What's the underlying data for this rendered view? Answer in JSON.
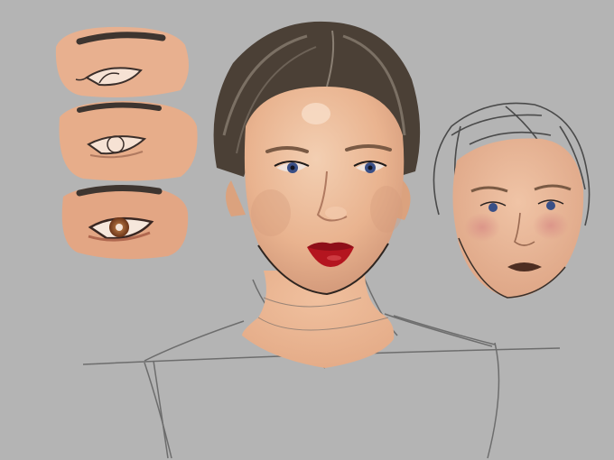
{
  "canvas": {
    "background": "#b4b4b4"
  },
  "palette": {
    "skin": "#e9b38f",
    "skin_light": "#f1c9aa",
    "skin_shadow": "#d49a7a",
    "blush": "#d98e86",
    "hair": "#4b4036",
    "hair_highlight": "#8a7f73",
    "lips": "#a8131c",
    "iris": "#394f86",
    "sketch_line": "#6a6a6a",
    "eye_study_iris": "#9a5a2a"
  },
  "subjects": [
    "eye-study-top",
    "eye-study-middle",
    "eye-study-bottom",
    "main-portrait",
    "sketch-portrait"
  ]
}
